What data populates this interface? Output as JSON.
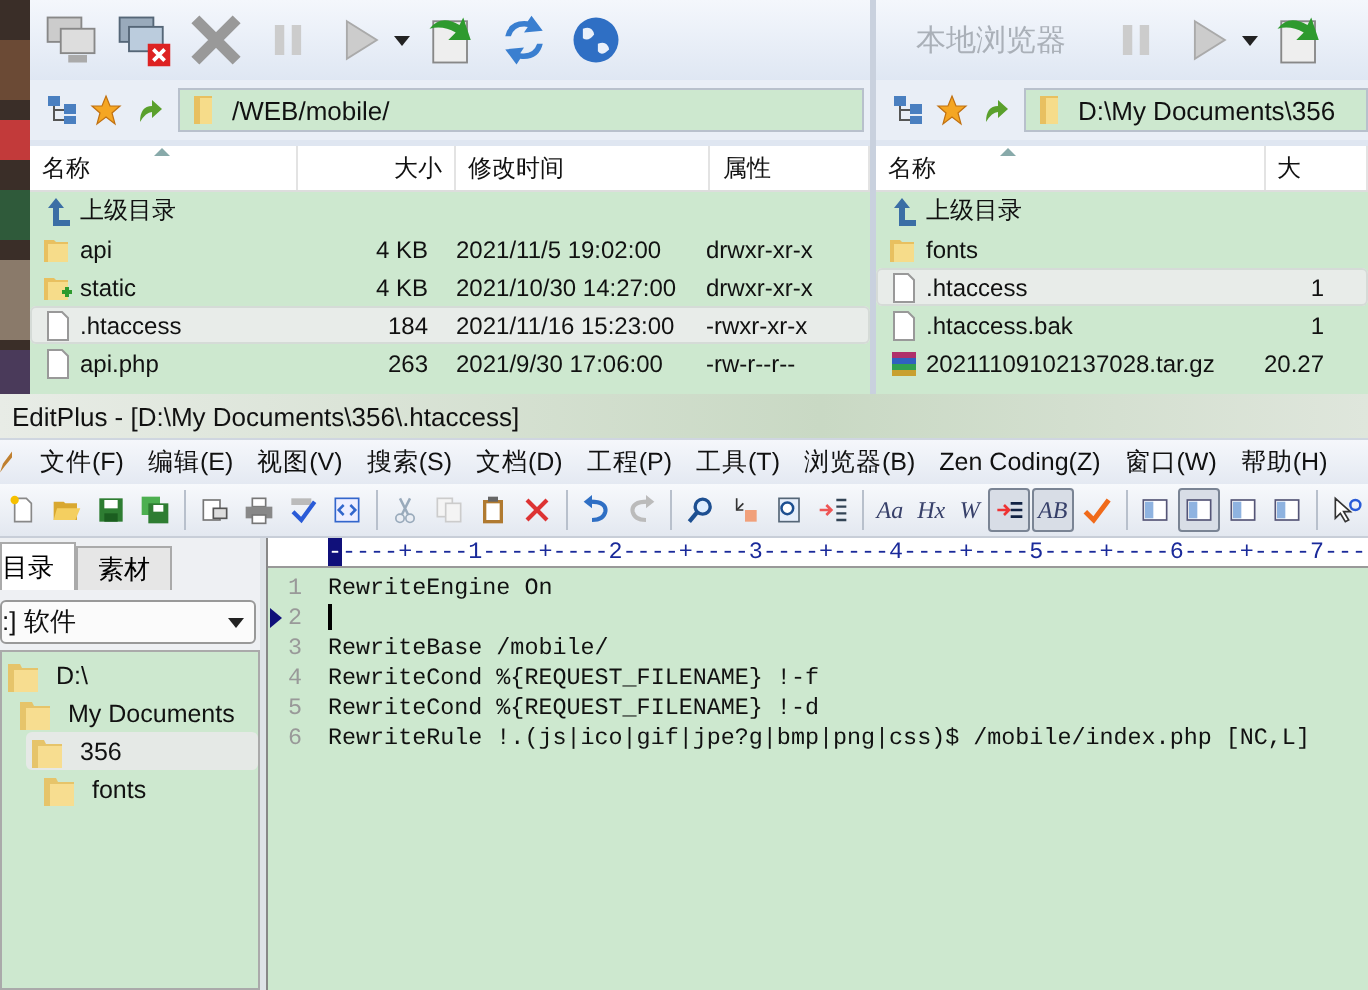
{
  "left_pane": {
    "path": "/WEB/mobile/",
    "columns": [
      "名称",
      "大小",
      "修改时间",
      "属性"
    ],
    "rows": [
      {
        "kind": "up",
        "name": "上级目录",
        "selected": false
      },
      {
        "kind": "folder",
        "name": "api",
        "size": "4 KB",
        "modified": "2021/11/5 19:02:00",
        "attributes": "drwxr-xr-x",
        "selected": false
      },
      {
        "kind": "folder-plus",
        "name": "static",
        "size": "4 KB",
        "modified": "2021/10/30 14:27:00",
        "attributes": "drwxr-xr-x",
        "selected": false
      },
      {
        "kind": "file",
        "name": ".htaccess",
        "size": "184",
        "modified": "2021/11/16 15:23:00",
        "attributes": "-rwxr-xr-x",
        "selected": true
      },
      {
        "kind": "file",
        "name": "api.php",
        "size": "263",
        "modified": "2021/9/30 17:06:00",
        "attributes": "-rw-r--r--",
        "selected": false
      }
    ]
  },
  "right_pane": {
    "title": "本地浏览器",
    "path": "D:\\My Documents\\356",
    "columns": [
      "名称",
      "大"
    ],
    "rows": [
      {
        "kind": "up",
        "name": "上级目录",
        "selected": false
      },
      {
        "kind": "folder",
        "name": "fonts",
        "selected": false
      },
      {
        "kind": "file",
        "name": ".htaccess",
        "size": "1",
        "selected": true
      },
      {
        "kind": "file",
        "name": ".htaccess.bak",
        "size": "1",
        "selected": false
      },
      {
        "kind": "archive",
        "name": "20211109102137028.tar.gz",
        "size": "20.27",
        "selected": false
      }
    ]
  },
  "editor_window": {
    "title": "EditPlus - [D:\\My Documents\\356\\.htaccess]",
    "menu": [
      "文件(F)",
      "编辑(E)",
      "视图(V)",
      "搜索(S)",
      "文档(D)",
      "工程(P)",
      "工具(T)",
      "浏览器(B)",
      "Zen Coding(Z)",
      "窗口(W)",
      "帮助(H)"
    ],
    "toolbar": [
      {
        "kind": "new"
      },
      {
        "kind": "open"
      },
      {
        "kind": "save"
      },
      {
        "kind": "save-all"
      },
      {
        "kind": "sep"
      },
      {
        "kind": "preview"
      },
      {
        "kind": "print"
      },
      {
        "kind": "spell"
      },
      {
        "kind": "browser"
      },
      {
        "kind": "sep"
      },
      {
        "kind": "cut"
      },
      {
        "kind": "copy"
      },
      {
        "kind": "paste"
      },
      {
        "kind": "delete"
      },
      {
        "kind": "sep"
      },
      {
        "kind": "undo"
      },
      {
        "kind": "redo"
      },
      {
        "kind": "sep"
      },
      {
        "kind": "find"
      },
      {
        "kind": "replace"
      },
      {
        "kind": "find-files"
      },
      {
        "kind": "goto"
      },
      {
        "kind": "sep"
      },
      {
        "kind": "glyph",
        "glyph": "Aa",
        "pressed": false
      },
      {
        "kind": "glyph",
        "glyph": "Hx",
        "pressed": false
      },
      {
        "kind": "glyph",
        "glyph": "W",
        "pressed": false
      },
      {
        "kind": "wrap",
        "pressed": true
      },
      {
        "kind": "glyph",
        "glyph": "AB",
        "pressed": true
      },
      {
        "kind": "check"
      },
      {
        "kind": "sep"
      },
      {
        "kind": "panel",
        "pressed": false
      },
      {
        "kind": "panel",
        "pressed": true
      },
      {
        "kind": "panel",
        "pressed": false
      },
      {
        "kind": "panel",
        "pressed": false
      },
      {
        "kind": "sep"
      },
      {
        "kind": "help"
      }
    ],
    "tabs": [
      {
        "label": "目录",
        "selected": true
      },
      {
        "label": "素材",
        "selected": false
      }
    ],
    "drive": ":] 软件",
    "tree": [
      {
        "label": "D:\\",
        "selected": false,
        "children": [
          {
            "label": "My Documents",
            "selected": false,
            "children": [
              {
                "label": "356",
                "selected": true,
                "children": [
                  {
                    "label": "fonts",
                    "selected": false
                  }
                ]
              }
            ]
          }
        ]
      }
    ],
    "ruler": "-----+----1----+----2----+----3----+----4----+----5----+----6----+----7---",
    "lines": [
      {
        "number": "1",
        "text": "RewriteEngine On",
        "current": false
      },
      {
        "number": "2",
        "current": true
      },
      {
        "number": "3",
        "text": "RewriteBase /mobile/",
        "current": false
      },
      {
        "number": "4",
        "text": "RewriteCond %{REQUEST_FILENAME} !-f",
        "current": false
      },
      {
        "number": "5",
        "text": "RewriteCond %{REQUEST_FILENAME} !-d",
        "current": false
      },
      {
        "number": "6",
        "text": "RewriteRule !.(js|ico|gif|jpe?g|bmp|png|css)$ /mobile/index.php [NC,L]",
        "current": false
      }
    ]
  }
}
